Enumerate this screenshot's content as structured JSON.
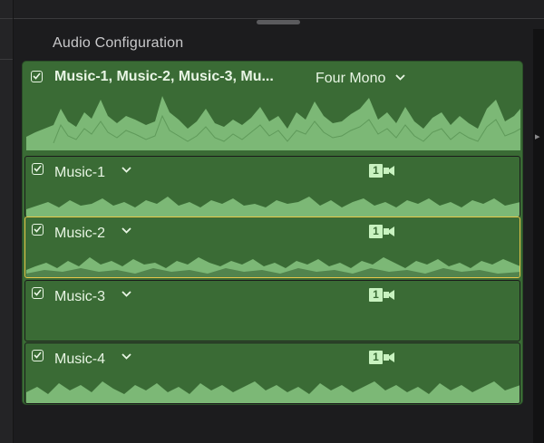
{
  "panel": {
    "section_title": "Audio Configuration",
    "header": {
      "enabled": true,
      "title": "Music-1, Music-2, Music-3, Mu...",
      "config_value": "Four Mono",
      "chevron_icon": "chevron-down-icon"
    },
    "channels": [
      {
        "label": "Music-1",
        "enabled": true,
        "badge_number": "1",
        "badge_icon": "video-camera-icon",
        "selected": false
      },
      {
        "label": "Music-2",
        "enabled": true,
        "badge_number": "1",
        "badge_icon": "video-camera-icon",
        "selected": true
      },
      {
        "label": "Music-3",
        "enabled": true,
        "badge_number": "1",
        "badge_icon": "video-camera-icon",
        "selected": false
      },
      {
        "label": "Music-4",
        "enabled": true,
        "badge_number": "1",
        "badge_icon": "video-camera-icon",
        "selected": false
      }
    ]
  },
  "colors": {
    "panel_green": "#3a6b35",
    "waveform_light": "#7cb876",
    "waveform_dark": "#2f5a2b",
    "text_light": "#e8f5e4",
    "selection_border": "#e8c84a",
    "background": "#1c1c1e"
  }
}
